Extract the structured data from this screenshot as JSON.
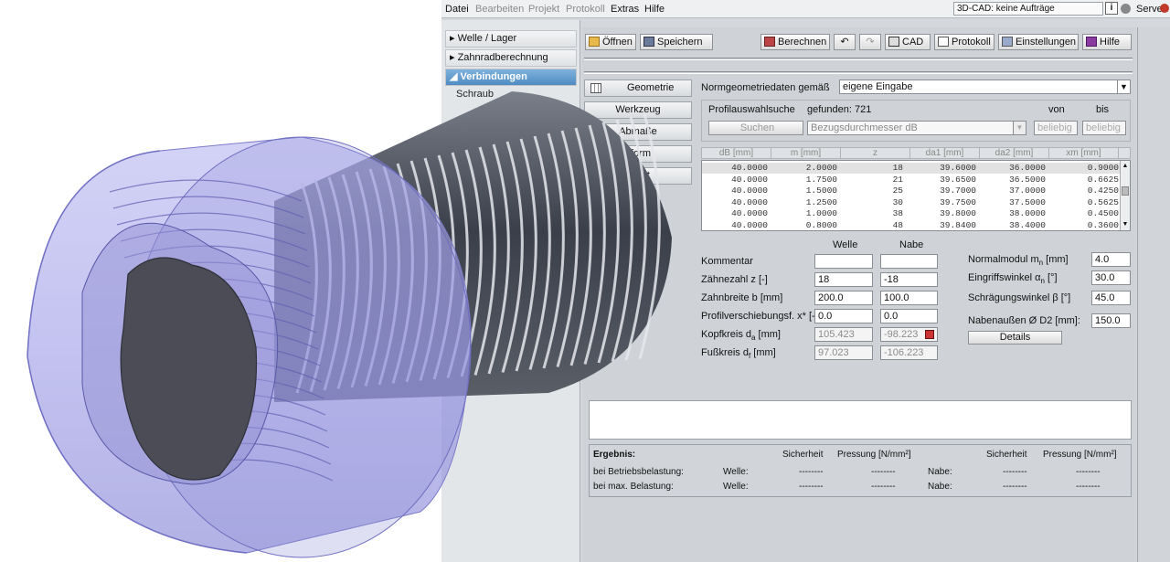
{
  "menu": [
    "Datei",
    "Bearbeiten",
    "Projekt",
    "Protokoll",
    "Extras",
    "Hilfe"
  ],
  "cad_status": "3D-CAD: keine Aufträge",
  "info_icon": "i",
  "server_label": "Server:",
  "colors": {
    "accent": "#4f8bc2",
    "server_dot": "#c0392b"
  },
  "sidebar": {
    "items": [
      "▸ Welle / Lager",
      "▸ Zahnradberechnung",
      "◢ Verbindungen"
    ],
    "sub": [
      "Schraub"
    ]
  },
  "toolbar": {
    "open": "Öffnen",
    "save": "Speichern",
    "calc": "Berechnen",
    "undo": "↶",
    "redo": "↷",
    "cad": "CAD",
    "protocol": "Protokoll",
    "settings": "Einstellungen",
    "help": "Hilfe"
  },
  "tabs": [
    "Geometrie",
    "Werkzeug",
    "Abmaße",
    "nform",
    "igkeit"
  ],
  "geometry": {
    "norm_label": "Normgeometriedaten gemäß",
    "norm_value": "eigene Eingabe",
    "profile_search": "Profilauswahlsuche",
    "found": "gefunden: 721",
    "search_btn": "Suchen",
    "ref_select": "Bezugsdurchmesser dB",
    "from": "von",
    "to": "bis",
    "from_val": "beliebig",
    "to_val": "beliebig"
  },
  "table": {
    "headers": [
      "dB [mm]",
      "m [mm]",
      "z",
      "da1 [mm]",
      "da2 [mm]",
      "xm [mm]"
    ],
    "rows": [
      [
        "40.0000",
        "2.0000",
        "18",
        "39.6000",
        "36.0000",
        "0.9000"
      ],
      [
        "40.0000",
        "1.7500",
        "21",
        "39.6500",
        "36.5000",
        "0.6625"
      ],
      [
        "40.0000",
        "1.5000",
        "25",
        "39.7000",
        "37.0000",
        "0.4250"
      ],
      [
        "40.0000",
        "1.2500",
        "30",
        "39.7500",
        "37.5000",
        "0.5625"
      ],
      [
        "40.0000",
        "1.0000",
        "38",
        "39.8000",
        "38.0000",
        "0.4500"
      ],
      [
        "40.0000",
        "0.8000",
        "48",
        "39.8400",
        "38.4000",
        "0.3600"
      ]
    ]
  },
  "params": {
    "col_welle": "Welle",
    "col_nabe": "Nabe",
    "rows": [
      {
        "label": "Kommentar",
        "welle": "",
        "nabe": "",
        "ro": false
      },
      {
        "label": "Zähnezahl z [-]",
        "welle": "18",
        "nabe": "-18",
        "ro": false
      },
      {
        "label": "Zahnbreite b [mm]",
        "welle": "200.0",
        "nabe": "100.0",
        "ro": false
      },
      {
        "label": "Profilverschiebungsf. x* [-]",
        "welle": "0.0",
        "nabe": "0.0",
        "ro": false
      },
      {
        "label": "Kopfkreis d [mm]",
        "sub": "a",
        "welle": "105.423",
        "nabe": "-98.223",
        "ro": true
      },
      {
        "label": "Fußkreis d [mm]",
        "sub": "f",
        "welle": "97.023",
        "nabe": "-106.223",
        "ro": true
      }
    ],
    "right": [
      {
        "label": "Normalmodul m [mm]",
        "sub": "n",
        "value": "4.0"
      },
      {
        "label": "Eingriffswinkel α [°]",
        "sub": "n",
        "value": "30.0"
      },
      {
        "label": "Schrägungswinkel β [°]",
        "value": "45.0"
      },
      {
        "label": "Nabenaußen Ø D2 [mm]:",
        "value": "150.0"
      }
    ],
    "details": "Details"
  },
  "results": {
    "title": "Ergebnis:",
    "h_safety": "Sicherheit",
    "h_pressure": "Pressung [N/mm²]",
    "rows": [
      {
        "label": "bei Betriebsbelastung:",
        "welle": "Welle:",
        "nabe": "Nabe:",
        "v": "--------"
      },
      {
        "label": "bei max. Belastung:",
        "welle": "Welle:",
        "nabe": "Nabe:",
        "v": "--------"
      }
    ]
  }
}
